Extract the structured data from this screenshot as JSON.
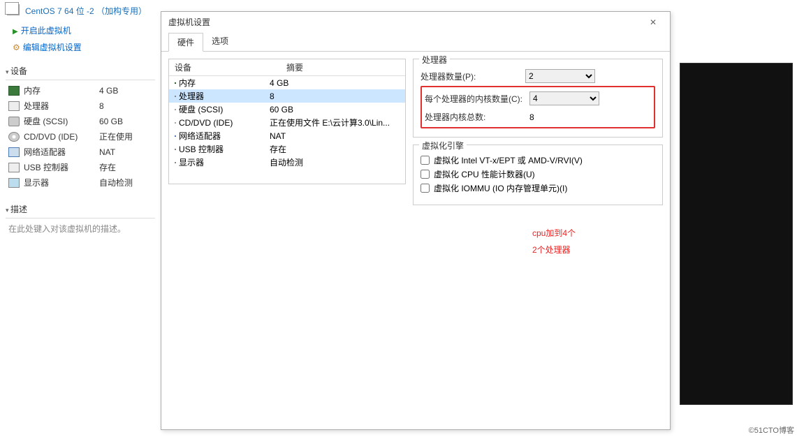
{
  "vm": {
    "title": "CentOS 7 64 位 -2 （加构专用）",
    "actions": {
      "power_on": "开启此虚拟机",
      "edit": "编辑虚拟机设置"
    }
  },
  "sections": {
    "devices": "设备",
    "description": "描述"
  },
  "desc_placeholder": "在此处键入对该虚拟机的描述。",
  "device_rows": [
    {
      "icon": "i-mem",
      "name": "内存",
      "value": "4 GB"
    },
    {
      "icon": "i-cpu",
      "name": "处理器",
      "value": "8"
    },
    {
      "icon": "i-disk",
      "name": "硬盘 (SCSI)",
      "value": "60 GB"
    },
    {
      "icon": "i-cd",
      "name": "CD/DVD (IDE)",
      "value": "正在使用"
    },
    {
      "icon": "i-net",
      "name": "网络适配器",
      "value": "NAT"
    },
    {
      "icon": "i-usb",
      "name": "USB 控制器",
      "value": "存在"
    },
    {
      "icon": "i-display",
      "name": "显示器",
      "value": "自动检测"
    }
  ],
  "dialog": {
    "title": "虚拟机设置",
    "tabs": {
      "hardware": "硬件",
      "options": "选项"
    },
    "hw_head": {
      "device": "设备",
      "summary": "摘要"
    },
    "hw_rows": [
      {
        "icon": "i-mem",
        "name": "内存",
        "value": "4 GB",
        "selected": false
      },
      {
        "icon": "i-cpu",
        "name": "处理器",
        "value": "8",
        "selected": true
      },
      {
        "icon": "i-disk",
        "name": "硬盘 (SCSI)",
        "value": "60 GB",
        "selected": false
      },
      {
        "icon": "i-cd",
        "name": "CD/DVD (IDE)",
        "value": "正在使用文件 E:\\云计算3.0\\Lin...",
        "selected": false
      },
      {
        "icon": "i-net",
        "name": "网络适配器",
        "value": "NAT",
        "selected": false
      },
      {
        "icon": "i-usb",
        "name": "USB 控制器",
        "value": "存在",
        "selected": false
      },
      {
        "icon": "i-display",
        "name": "显示器",
        "value": "自动检测",
        "selected": false
      }
    ],
    "processors": {
      "group_title": "处理器",
      "count_label": "处理器数量(P):",
      "count_value": "2",
      "cores_label": "每个处理器的内核数量(C):",
      "cores_value": "4",
      "total_label": "处理器内核总数:",
      "total_value": "8"
    },
    "virt_engine": {
      "group_title": "虚拟化引擎",
      "vt": "虚拟化 Intel VT-x/EPT 或 AMD-V/RVI(V)",
      "perf": "虚拟化 CPU 性能计数器(U)",
      "iommu": "虚拟化 IOMMU (IO 内存管理单元)(I)"
    }
  },
  "annotation": {
    "line1": "cpu加到4个",
    "line2": "2个处理器"
  },
  "watermark": "©51CTO博客"
}
